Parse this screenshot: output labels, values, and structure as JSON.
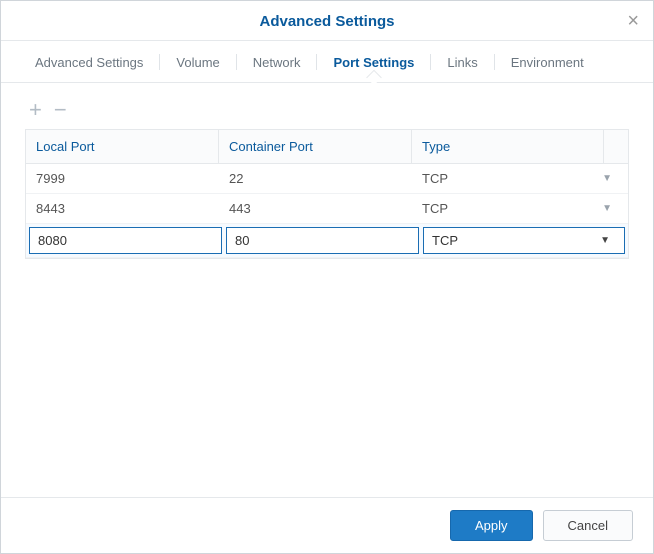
{
  "header": {
    "title": "Advanced Settings"
  },
  "tabs": [
    {
      "label": "Advanced Settings",
      "active": false
    },
    {
      "label": "Volume",
      "active": false
    },
    {
      "label": "Network",
      "active": false
    },
    {
      "label": "Port Settings",
      "active": true
    },
    {
      "label": "Links",
      "active": false
    },
    {
      "label": "Environment",
      "active": false
    }
  ],
  "columns": {
    "local_port": "Local Port",
    "container_port": "Container Port",
    "type": "Type"
  },
  "rows": [
    {
      "local_port": "7999",
      "container_port": "22",
      "type": "TCP",
      "editing": false
    },
    {
      "local_port": "8443",
      "container_port": "443",
      "type": "TCP",
      "editing": false
    },
    {
      "local_port": "8080",
      "container_port": "80",
      "type": "TCP",
      "editing": true
    }
  ],
  "footer": {
    "apply": "Apply",
    "cancel": "Cancel"
  }
}
